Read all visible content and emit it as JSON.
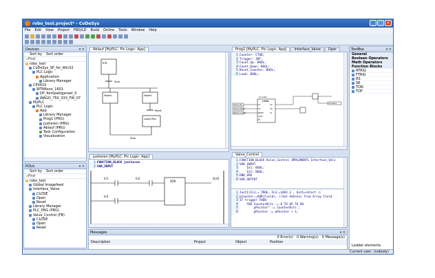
{
  "window": {
    "title": "robo_test.project* - CoDeSys"
  },
  "menu": [
    "File",
    "Edit",
    "View",
    "Project",
    "FBD/LD",
    "Build",
    "Online",
    "Tools",
    "Window",
    "Help"
  ],
  "devices": {
    "title": "Devices",
    "sort_by": "Sort by",
    "sort_order": "Sort order",
    "find": "Find",
    "tree": [
      {
        "label": "robo_test",
        "depth": 0,
        "icon": "f"
      },
      {
        "label": "CoDeSys_SP_for_Win32",
        "depth": 1,
        "icon": "b"
      },
      {
        "label": "PLC Logic",
        "depth": 2,
        "icon": "b"
      },
      {
        "label": "Application",
        "depth": 3,
        "icon": "o"
      },
      {
        "label": "Library Manager",
        "depth": 4,
        "icon": "b"
      },
      {
        "label": "CPX610",
        "depth": 1,
        "icon": "b"
      },
      {
        "label": "WTN6xxx_1601",
        "depth": 2,
        "icon": "b"
      },
      {
        "label": "DP_Kompaktgeraet_0",
        "depth": 3,
        "icon": "b"
      },
      {
        "label": "WAGO_750_333_FW_07",
        "depth": 3,
        "icon": "b"
      },
      {
        "label": "MyPLC",
        "depth": 1,
        "icon": "b"
      },
      {
        "label": "PLC Logic",
        "depth": 2,
        "icon": "b"
      },
      {
        "label": "App",
        "depth": 3,
        "icon": "o"
      },
      {
        "label": "Library Manager",
        "depth": 4,
        "icon": "b"
      },
      {
        "label": "Prog1 (PRG)",
        "depth": 4,
        "icon": "b"
      },
      {
        "label": "justieren (PRG)",
        "depth": 4,
        "icon": "b"
      },
      {
        "label": "Ablauf (PRG)",
        "depth": 4,
        "icon": "b"
      },
      {
        "label": "Task Configuration",
        "depth": 4,
        "icon": "g"
      },
      {
        "label": "Visualization",
        "depth": 4,
        "icon": "b"
      }
    ]
  },
  "pous": {
    "title": "POUs",
    "sort_by": "Sort by",
    "sort_order": "Sort order",
    "find": "Find",
    "tree": [
      {
        "label": "robo_test",
        "depth": 0,
        "icon": "f"
      },
      {
        "label": "Global Imagefeed",
        "depth": 1,
        "icon": "b"
      },
      {
        "label": "Interface_Valve",
        "depth": 1,
        "icon": "b"
      },
      {
        "label": "CLOSE",
        "depth": 2,
        "icon": "b"
      },
      {
        "label": "Open",
        "depth": 2,
        "icon": "b"
      },
      {
        "label": "Reset",
        "depth": 2,
        "icon": "b"
      },
      {
        "label": "Library Manager",
        "depth": 1,
        "icon": "b"
      },
      {
        "label": "PLC_PRG (PRG)",
        "depth": 1,
        "icon": "b"
      },
      {
        "label": "Valve_Control (FB)",
        "depth": 1,
        "icon": "b"
      },
      {
        "label": "CLOSE",
        "depth": 2,
        "icon": "b"
      },
      {
        "label": "Open",
        "depth": 2,
        "icon": "b"
      },
      {
        "label": "Reset",
        "depth": 2,
        "icon": "b"
      }
    ]
  },
  "sfc": {
    "tab": "Ablauf [MyPLC: Plc Logic: App]",
    "steps": [
      "Init",
      "Modell",
      "Modell",
      "Lower/Pos"
    ],
    "labels": [
      "Start",
      "Reset",
      "Step"
    ]
  },
  "justieren": {
    "tab": "justieren [MyPLC: Plc Logic: App]",
    "lines": [
      "FUNCTION_BLOCK justieren",
      "VAR_INPUT"
    ],
    "contacts": [
      "In1",
      "In2",
      "In3"
    ],
    "block": "XOR",
    "coil": "Out1"
  },
  "prog1": {
    "tabs": [
      "Prog1 [MyPLC: Plc Logic: App]",
      "Interface_Valve",
      "Oper"
    ],
    "lines": [
      "Counter: CTUD;",
      "Trigger: INT;",
      "Count_Up: BOOL;",
      "Count_Down: BOOL;",
      "Reset_Counter: BOOL;",
      "Load: BOOL;"
    ],
    "block_title": "CTUD",
    "block_name": "Counter",
    "inputs": [
      "Count_Up",
      "Count_Down",
      "Reset_Counter"
    ],
    "pins_in": [
      "CU",
      "CD",
      "RESET",
      "LOAD",
      "PV"
    ],
    "pins_out": [
      "QU",
      "QD",
      "CV"
    ],
    "right_label": "Counter1"
  },
  "valve": {
    "tab": "Valve_Control",
    "lines": [
      {
        "n": "1",
        "t": "FUNCTION_BLOCK Valve_Control IMPLEMENTS Interface_Valv"
      },
      {
        "n": "2",
        "t": "VAR_INPUT"
      },
      {
        "n": "3",
        "t": "    In1: BOOL;"
      },
      {
        "n": "4",
        "t": "    In2: BOOL;"
      },
      {
        "n": "5",
        "t": "END_VAR"
      },
      {
        "n": "6",
        "t": "VAR_OUTPUT"
      }
    ],
    "lines2": [
      {
        "n": "1",
        "t": "JustI(In1:= TRUE, In1:=16#3.3 , Out1=>Start );"
      },
      {
        "n": "2",
        "t": "pCounter:=ADR(Field); //Set Address from Array Field"
      },
      {
        "n": "3",
        "t": "IF trigger THEN"
      },
      {
        "n": "4",
        "t": "    FOR CounterBits := 0 TO UP TO DO"
      },
      {
        "n": "5",
        "t": "        pPointer^ := CounterBits ;"
      },
      {
        "n": "6",
        "t": "        pPointer := pPointer + 1;"
      }
    ]
  },
  "messages": {
    "title": "Messages",
    "filters": [
      "0 Error(s)",
      "0 Warning(s)",
      "0 Message(s)"
    ],
    "columns": [
      "Description",
      "Project",
      "Object",
      "Position"
    ],
    "precompile": "Precompile:",
    "ok": "OK",
    "bottom_tabs": [
      "Messages",
      "Call Stack"
    ]
  },
  "toolbox": {
    "title": "ToolBox",
    "items": [
      {
        "label": "General",
        "cat": true
      },
      {
        "label": "Boolean Operators",
        "cat": true
      },
      {
        "label": "Math Operators",
        "cat": true
      },
      {
        "label": "Function Blocks",
        "cat": true
      },
      {
        "label": "RTRIG",
        "cat": false
      },
      {
        "label": "FTRIG",
        "cat": false
      },
      {
        "label": "RS",
        "cat": false
      },
      {
        "label": "SR",
        "cat": false
      },
      {
        "label": "TON",
        "cat": false
      },
      {
        "label": "TOF",
        "cat": false
      }
    ],
    "ladder": "Ladder elements"
  },
  "status": {
    "user": "Current user: (nobody)"
  }
}
